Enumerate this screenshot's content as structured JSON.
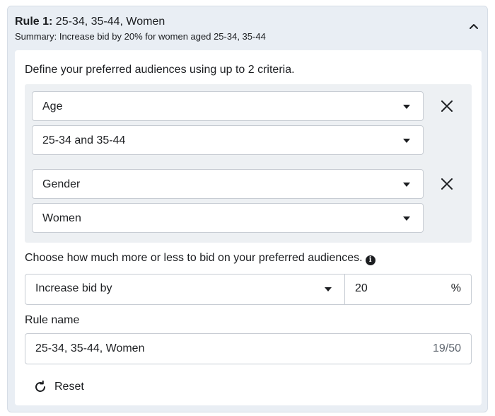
{
  "rule": {
    "title_prefix": "Rule 1:",
    "title_value": " 25-34, 35-44, Women",
    "summary": "Summary: Increase bid by 20% for women aged 25-34, 35-44"
  },
  "intro": "Define your preferred audiences using up to 2 criteria.",
  "criteria": [
    {
      "type": "Age",
      "value": "25-34 and 35-44"
    },
    {
      "type": "Gender",
      "value": "Women"
    }
  ],
  "bid": {
    "label": "Choose how much more or less to bid on your preferred audiences.",
    "action": "Increase bid by",
    "amount": "20",
    "unit": "%"
  },
  "rule_name": {
    "label": "Rule name",
    "value": "25-34, 35-44, Women",
    "count": "19/50"
  },
  "reset_label": "Reset",
  "icons": {
    "collapse": "chevron-up-icon",
    "remove": "close-icon",
    "info": "info-icon",
    "reset": "refresh-icon"
  }
}
